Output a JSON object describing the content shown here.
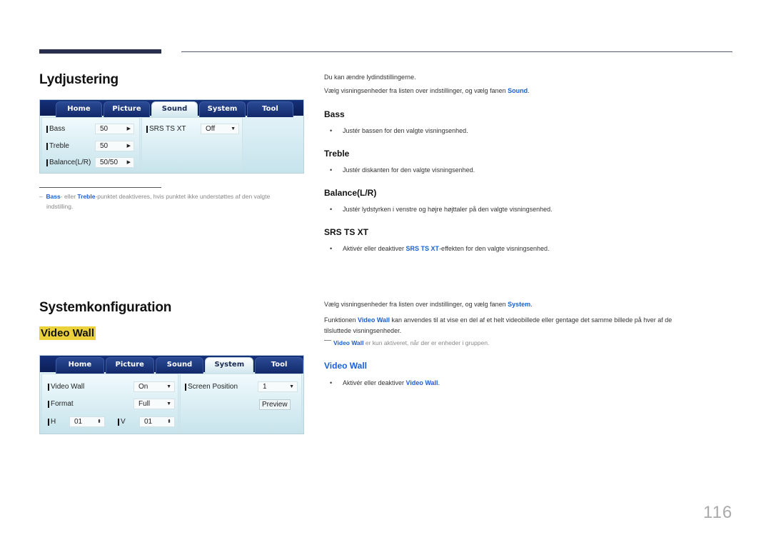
{
  "section1": {
    "title": "Lydjustering",
    "panel": {
      "tabs": [
        "Home",
        "Picture",
        "Sound",
        "System",
        "Tool"
      ],
      "active_tab": "Sound",
      "fields": [
        {
          "label": "Bass",
          "value": "50",
          "control": "arrow-right"
        },
        {
          "label": "Treble",
          "value": "50",
          "control": "arrow-right"
        },
        {
          "label": "Balance(L/R)",
          "value": "50/50",
          "control": "arrow-right"
        }
      ],
      "srs": {
        "label": "SRS TS XT",
        "value": "Off",
        "control": "dropdown"
      }
    },
    "note": {
      "dash": "–",
      "bass": "Bass",
      "mid": "- eller ",
      "treble": "Treble",
      "rest": "-punktet deaktiveres, hvis punktet ikke understøttes af den valgte",
      "line2": "indstilling."
    },
    "intro": "Du kan ændre lydindstillingerne.",
    "select_pre": "Vælg visningsenheder fra listen over indstillinger, og vælg fanen ",
    "select_link": "Sound",
    "items": [
      {
        "heading": "Bass",
        "bullet": "Justér bassen for den valgte visningsenhed."
      },
      {
        "heading": "Treble",
        "bullet": "Justér diskanten for den valgte visningsenhed."
      },
      {
        "heading": "Balance(L/R)",
        "bullet": "Justér lydstyrken i venstre og højre højttaler på den valgte visningsenhed."
      },
      {
        "heading": "SRS TS XT",
        "bullet_pre": "Aktivér eller deaktiver ",
        "bullet_link": "SRS TS XT",
        "bullet_post": "-effekten for den valgte visningsenhed."
      }
    ]
  },
  "section2": {
    "title": "Systemkonfiguration",
    "subtitle": "Video Wall",
    "panel": {
      "tabs": [
        "Home",
        "Picture",
        "Sound",
        "System",
        "Tool"
      ],
      "active_tab": "System",
      "video_wall": {
        "label": "Video Wall",
        "value": "On"
      },
      "format": {
        "label": "Format",
        "value": "Full"
      },
      "h": {
        "label": "H",
        "value": "01"
      },
      "v": {
        "label": "V",
        "value": "01"
      },
      "screen_position": {
        "label": "Screen Position",
        "value": "1"
      },
      "preview_button": "Preview"
    },
    "select_pre": "Vælg visningsenheder fra listen over indstillinger, og vælg fanen ",
    "select_link": "System",
    "func_pre": "Funktionen ",
    "func_link": "Video Wall",
    "func_post": " kan anvendes til at vise en del af et helt videobillede eller gentage det samme billede på hver af de",
    "func_line2": "tilsluttede visningsenheder.",
    "note_link": "Video Wall",
    "note_rest": " er kun aktiveret, når der er enheder i gruppen.",
    "item": {
      "heading": "Video Wall",
      "bullet_pre": "Aktivér eller deaktiver ",
      "bullet_link": "Video Wall",
      "bullet_post": "."
    }
  },
  "page_number": "116",
  "colors": {
    "accent_blue": "#1a5fd6",
    "highlight_yellow": "#ecd23a",
    "tab_navy": "#0b1d55"
  }
}
